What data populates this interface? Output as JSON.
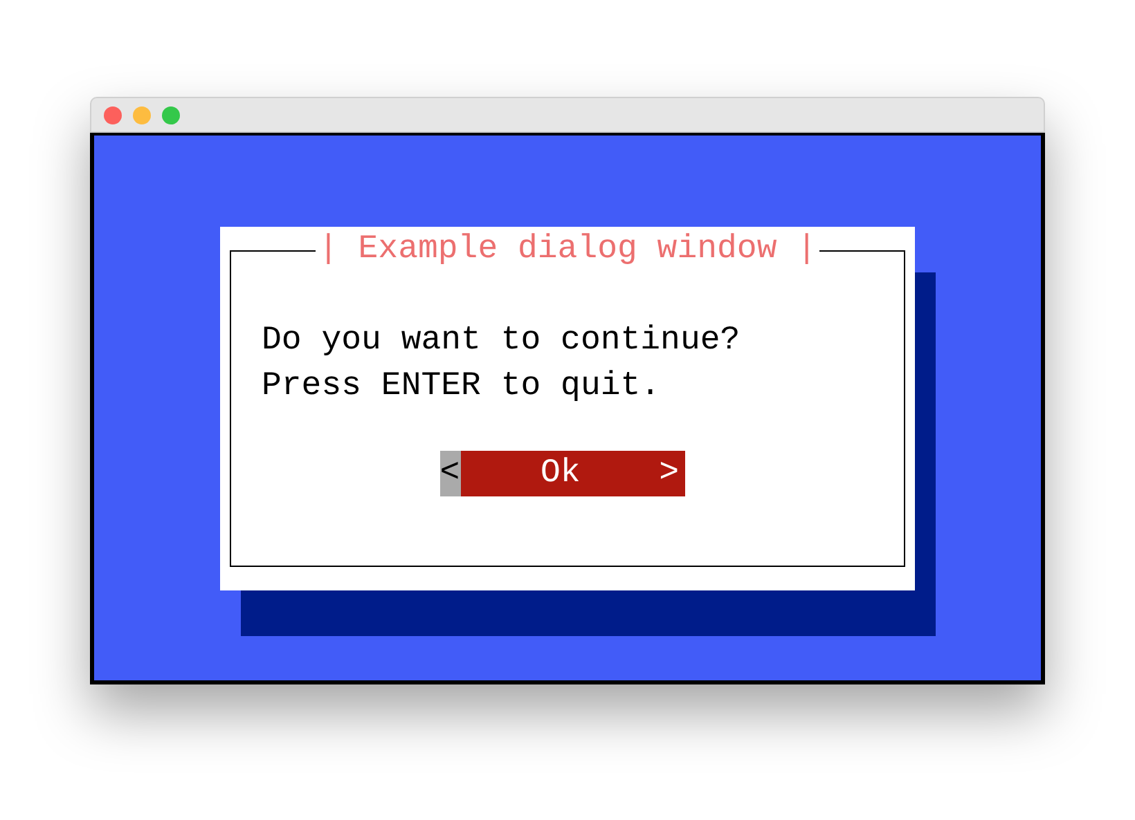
{
  "dialog": {
    "title": "| Example dialog window |",
    "message": [
      "Do you want to continue?",
      "Press ENTER to quit."
    ],
    "button": {
      "left": "<",
      "label": "Ok",
      "right": ">",
      "selected": true
    }
  }
}
